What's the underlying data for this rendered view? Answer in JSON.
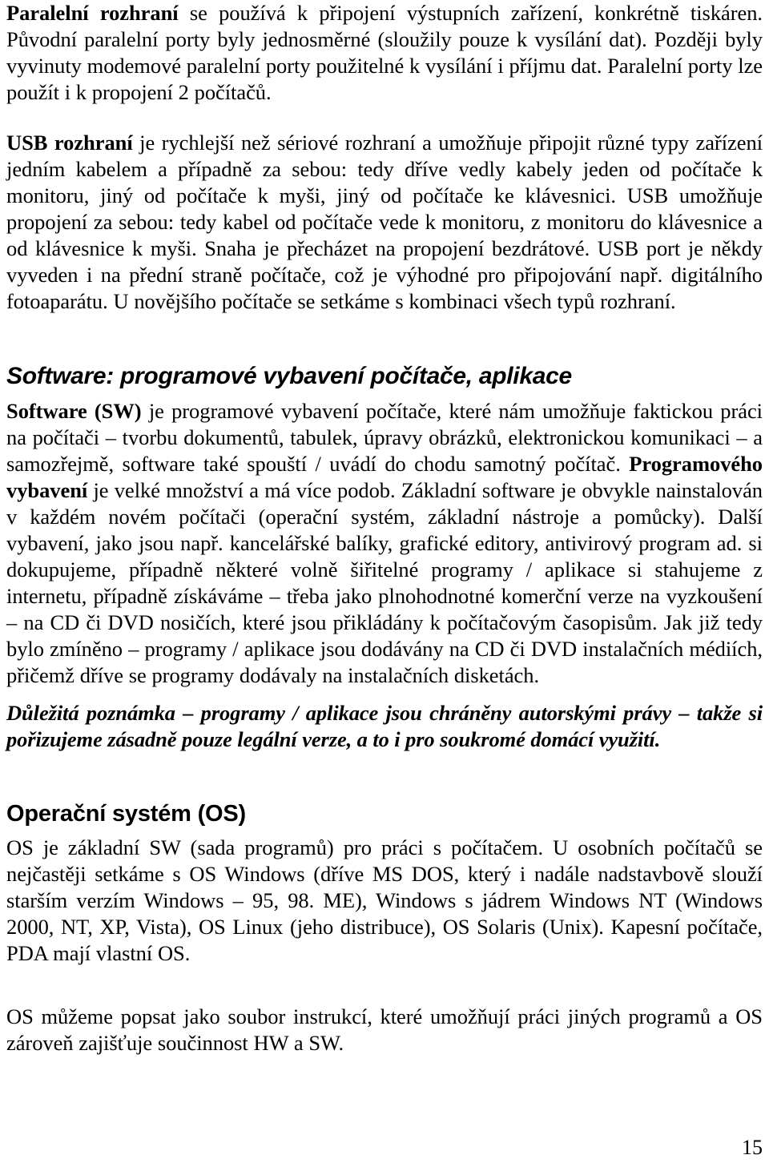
{
  "document": {
    "page_number": "15",
    "language": "cs"
  },
  "sections": {
    "parallel": {
      "lead_bold": "Paralelní rozhraní",
      "body": " se používá k připojení výstupních zařízení, konkrétně tiskáren. Původní paralelní porty byly jednosměrné (sloužily pouze k vysílání dat). Později byly vyvinuty modemové paralelní porty použitelné k vysílání i příjmu dat. Paralelní porty lze použít i k propojení 2 počítačů."
    },
    "usb": {
      "lead_bold": "USB rozhraní",
      "body": " je rychlejší než sériové rozhraní a umožňuje připojit různé typy zařízení jedním kabelem a případně za sebou: tedy dříve vedly kabely jeden od počítače k monitoru, jiný od počítače k myši, jiný od počítače ke klávesnici. USB umožňuje propojení za sebou: tedy kabel od počítače vede k monitoru, z monitoru do klávesnice a od klávesnice k myši. Snaha je přecházet na propojení bezdrátové. USB port je někdy vyveden i na přední straně počítače, což je výhodné pro připojování např. digitálního fotoaparátu. U novějšího počítače se setkáme s kombinaci všech typů rozhraní."
    },
    "software": {
      "heading": "Software: programové vybavení počítače, aplikace",
      "lead_bold": "Software (SW)",
      "body_part1": " je programové vybavení počítače, které nám umožňuje faktickou práci na počítači – tvorbu dokumentů, tabulek, úpravy obrázků, elektronickou komunikaci – a samozřejmě, software také spouští / uvádí do chodu samotný počítač. ",
      "inline_bold": "Programového vybavení",
      "body_part2": " je velké množství a má více podob. Základní software je obvykle nainstalován v každém novém počítači (operační systém, základní nástroje a pomůcky). Další vybavení, jako jsou např. kancelářské balíky, grafické editory, antivirový program ad. si dokupujeme, případně některé volně šiřitelné programy / aplikace si stahujeme z internetu, případně získáváme – třeba jako plnohodnotné komerční verze na vyzkoušení – na CD či DVD nosičích, které jsou přikládány k počítačovým časopisům. Jak již tedy bylo zmíněno – programy / aplikace jsou dodávány na CD či DVD instalačních médiích, přičemž dříve se programy dodávaly na instalačních disketách.",
      "note": "Důležitá poznámka – programy / aplikace jsou chráněny autorskými právy – takže si pořizujeme zásadně pouze legální verze, a to i pro soukromé domácí využití."
    },
    "os": {
      "heading": "Operační systém (OS)",
      "paragraph1": "OS je základní SW (sada programů) pro práci s počítačem. U osobních počítačů se nejčastěji setkáme s OS Windows (dříve MS DOS, který i nadále nadstavbově slouží starším verzím Windows – 95, 98. ME), Windows s jádrem Windows NT (Windows 2000, NT, XP, Vista), OS Linux (jeho distribuce), OS Solaris (Unix). Kapesní počítače, PDA mají vlastní OS.",
      "paragraph2": "OS můžeme popsat jako soubor instrukcí, které umožňují práci jiných programů a OS zároveň zajišťuje součinnost HW a SW."
    }
  }
}
